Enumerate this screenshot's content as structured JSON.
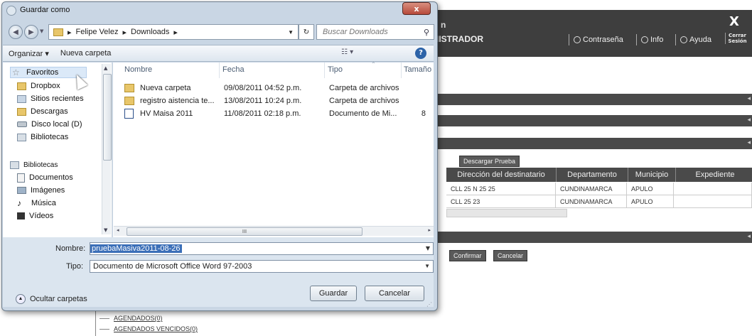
{
  "background": {
    "header": {
      "title_partial": "n",
      "role_partial": "IISTRADOR",
      "nav": [
        "Contraseña",
        "Info",
        "Ayuda"
      ],
      "close_label": "X",
      "logout_label": "Cerrar Sesión"
    },
    "download_button": "Descargar Prueba",
    "grid": {
      "headers": [
        "Dirección del destinatario",
        "Departamento",
        "Municipio",
        "Expediente"
      ],
      "rows": [
        [
          "CLL 25 N 25 25",
          "CUNDINAMARCA",
          "APULO",
          ""
        ],
        [
          "CLL 25 23",
          "CUNDINAMARCA",
          "APULO",
          ""
        ]
      ]
    },
    "confirm_button": "Confirmar",
    "cancel_button": "Cancelar",
    "tree_items": [
      "AGENDADOS(0)",
      "AGENDADOS VENCIDOS(0)"
    ]
  },
  "dialog": {
    "title": "Guardar como",
    "close_label": "x",
    "breadcrumb": [
      "Felipe Velez",
      "Downloads"
    ],
    "search_placeholder": "Buscar Downloads",
    "toolbar": {
      "organize": "Organizar ▾",
      "new_folder": "Nueva carpeta"
    },
    "nav_items": [
      {
        "label": "Favoritos",
        "icon": "star-icon"
      },
      {
        "label": "Dropbox",
        "icon": "folder-icon"
      },
      {
        "label": "Sitios recientes",
        "icon": "recent-places-icon"
      },
      {
        "label": "Descargas",
        "icon": "downloads-folder-icon"
      },
      {
        "label": "Disco local (D)",
        "icon": "drive-icon"
      },
      {
        "label": "Bibliotecas",
        "icon": "library-icon"
      },
      {
        "label": "Bibliotecas",
        "icon": "library-icon"
      },
      {
        "label": "Documentos",
        "icon": "documents-icon"
      },
      {
        "label": "Imágenes",
        "icon": "pictures-icon"
      },
      {
        "label": "Música",
        "icon": "music-icon"
      },
      {
        "label": "Vídeos",
        "icon": "videos-icon"
      }
    ],
    "columns": [
      "Nombre",
      "Fecha",
      "Tipo",
      "Tamaño"
    ],
    "files": [
      {
        "name": "Nueva carpeta",
        "date": "09/08/2011 04:52 p.m.",
        "type": "Carpeta de archivos",
        "size": "",
        "icon": "folder-icon"
      },
      {
        "name": "registro aistencia te...",
        "date": "13/08/2011 10:24 p.m.",
        "type": "Carpeta de archivos",
        "size": "",
        "icon": "folder-icon"
      },
      {
        "name": "HV Maisa 2011",
        "date": "11/08/2011 02:18 p.m.",
        "type": "Documento de Mi...",
        "size": "8",
        "icon": "word-document-icon"
      }
    ],
    "filename_label": "Nombre:",
    "filename_value": "pruebaMasiva2011-08-26",
    "type_label": "Tipo:",
    "type_value": "Documento de Microsoft Office Word 97-2003",
    "hide_folders": "Ocultar carpetas",
    "save_button": "Guardar",
    "cancel_button": "Cancelar",
    "hscroll_grip": "III"
  }
}
